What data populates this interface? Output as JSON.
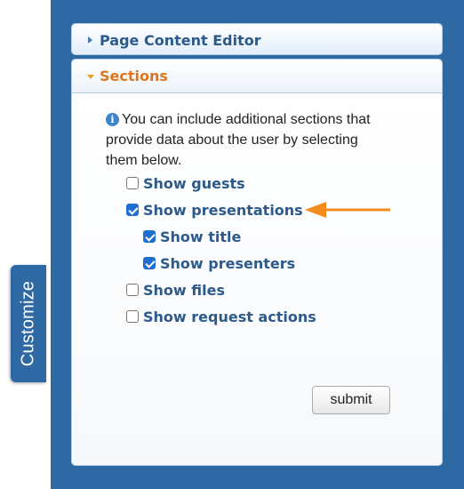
{
  "customize_tab": {
    "label": "Customize"
  },
  "page_content_editor": {
    "title": "Page Content Editor"
  },
  "sections": {
    "title": "Sections",
    "info_text": "You can include additional sections that provide data about the user by selecting them below.",
    "options": [
      {
        "label": "Show guests",
        "checked": false
      },
      {
        "label": "Show presentations",
        "checked": true
      },
      {
        "label": "Show title",
        "checked": true
      },
      {
        "label": "Show presenters",
        "checked": true
      },
      {
        "label": "Show files",
        "checked": false
      },
      {
        "label": "Show request actions",
        "checked": false
      }
    ],
    "submit_label": "submit"
  },
  "colors": {
    "panel_blue": "#2f69a3",
    "header_text": "#2c5a8a",
    "sections_title": "#e0761c",
    "arrow": "#f28c1c",
    "checkbox_checked": "#1f6fd0"
  },
  "icons": {
    "info": "info-icon",
    "collapsed": "triangle-right-icon",
    "expanded": "triangle-down-icon",
    "pointer": "orange-arrow-icon"
  }
}
